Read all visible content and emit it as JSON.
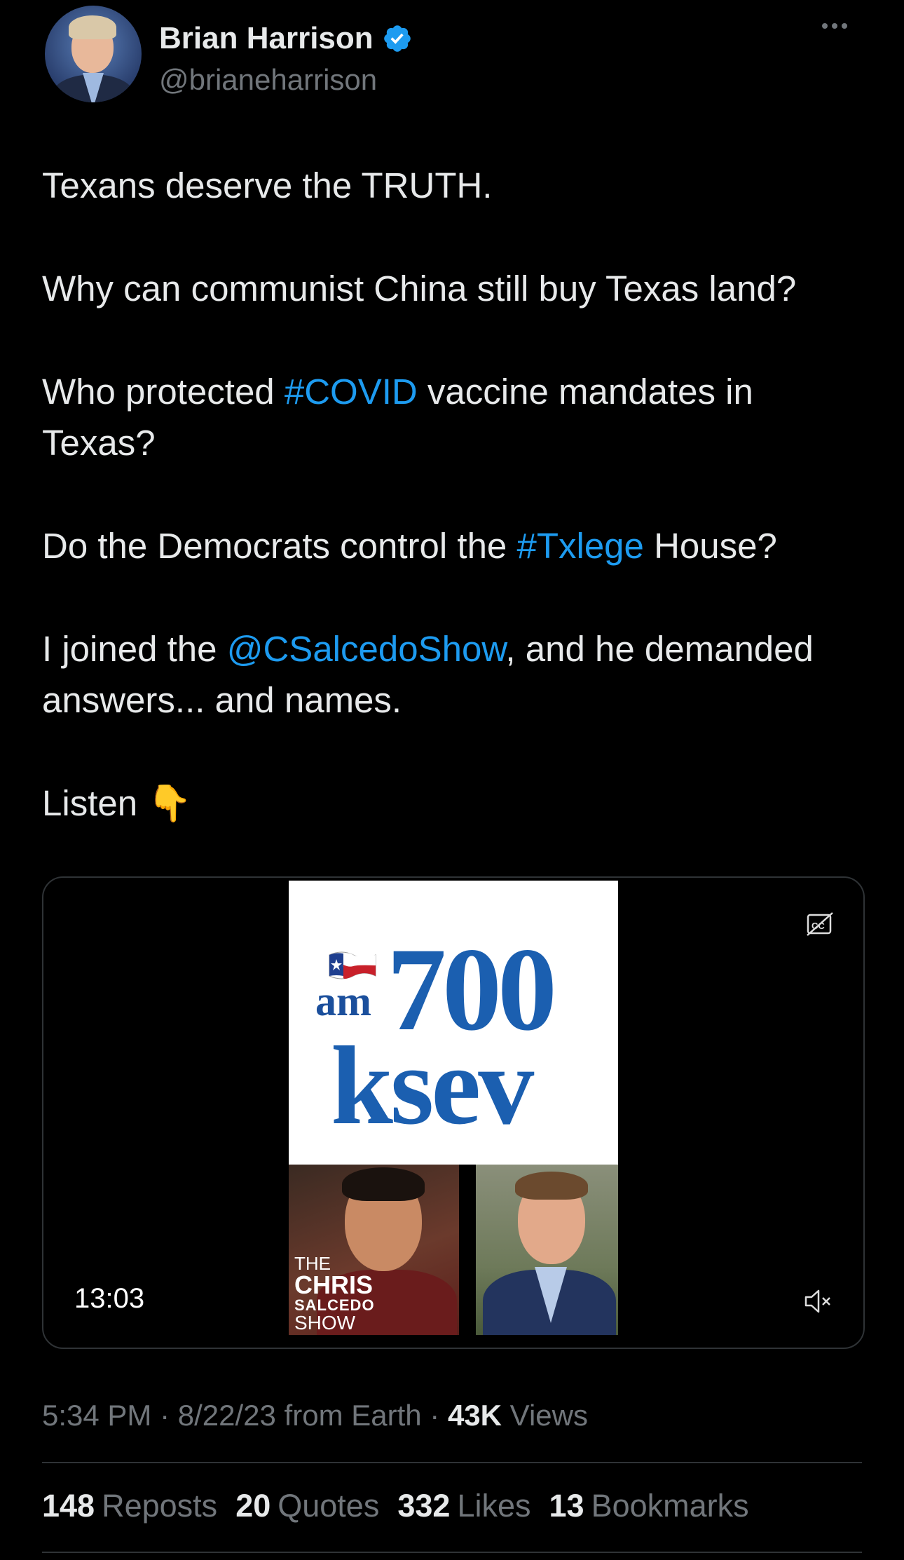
{
  "author": {
    "display_name": "Brian Harrison",
    "handle": "@brianeharrison",
    "verified": true,
    "verified_color": "#1d9bf0"
  },
  "tweet": {
    "line1": "Texans deserve the TRUTH.",
    "line2": "Why can communist China still buy Texas land?",
    "line3_pre": "Who protected ",
    "line3_tag": "#COVID",
    "line3_post": " vaccine mandates in Texas?",
    "line4_pre": "Do the Democrats control the ",
    "line4_tag": "#Txlege",
    "line4_post": " House?",
    "line5_pre": "I joined the ",
    "line5_mention": "@CSalcedoShow",
    "line5_post": ", and he demanded answers... and names.",
    "line6": "Listen 👇",
    "link_color": "#1d9bf0"
  },
  "media": {
    "logo_am": "am",
    "logo_700": "700",
    "logo_ksev": "ksev",
    "show_the": "THE",
    "show_chris": "CHRIS",
    "show_salcedo": "SALCEDO",
    "show_show": "SHOW",
    "duration": "13:03",
    "captions_icon": "captions-off-icon",
    "mute_icon": "volume-muted-icon"
  },
  "meta": {
    "time": "5:34 PM",
    "sep1": " · ",
    "date": "8/22/23",
    "source": " from Earth",
    "sep2": " · ",
    "views_count": "43K",
    "views_label": " Views"
  },
  "stats": {
    "reposts_count": "148",
    "reposts_label": "Reposts",
    "quotes_count": "20",
    "quotes_label": "Quotes",
    "likes_count": "332",
    "likes_label": "Likes",
    "bookmarks_count": "13",
    "bookmarks_label": "Bookmarks"
  }
}
